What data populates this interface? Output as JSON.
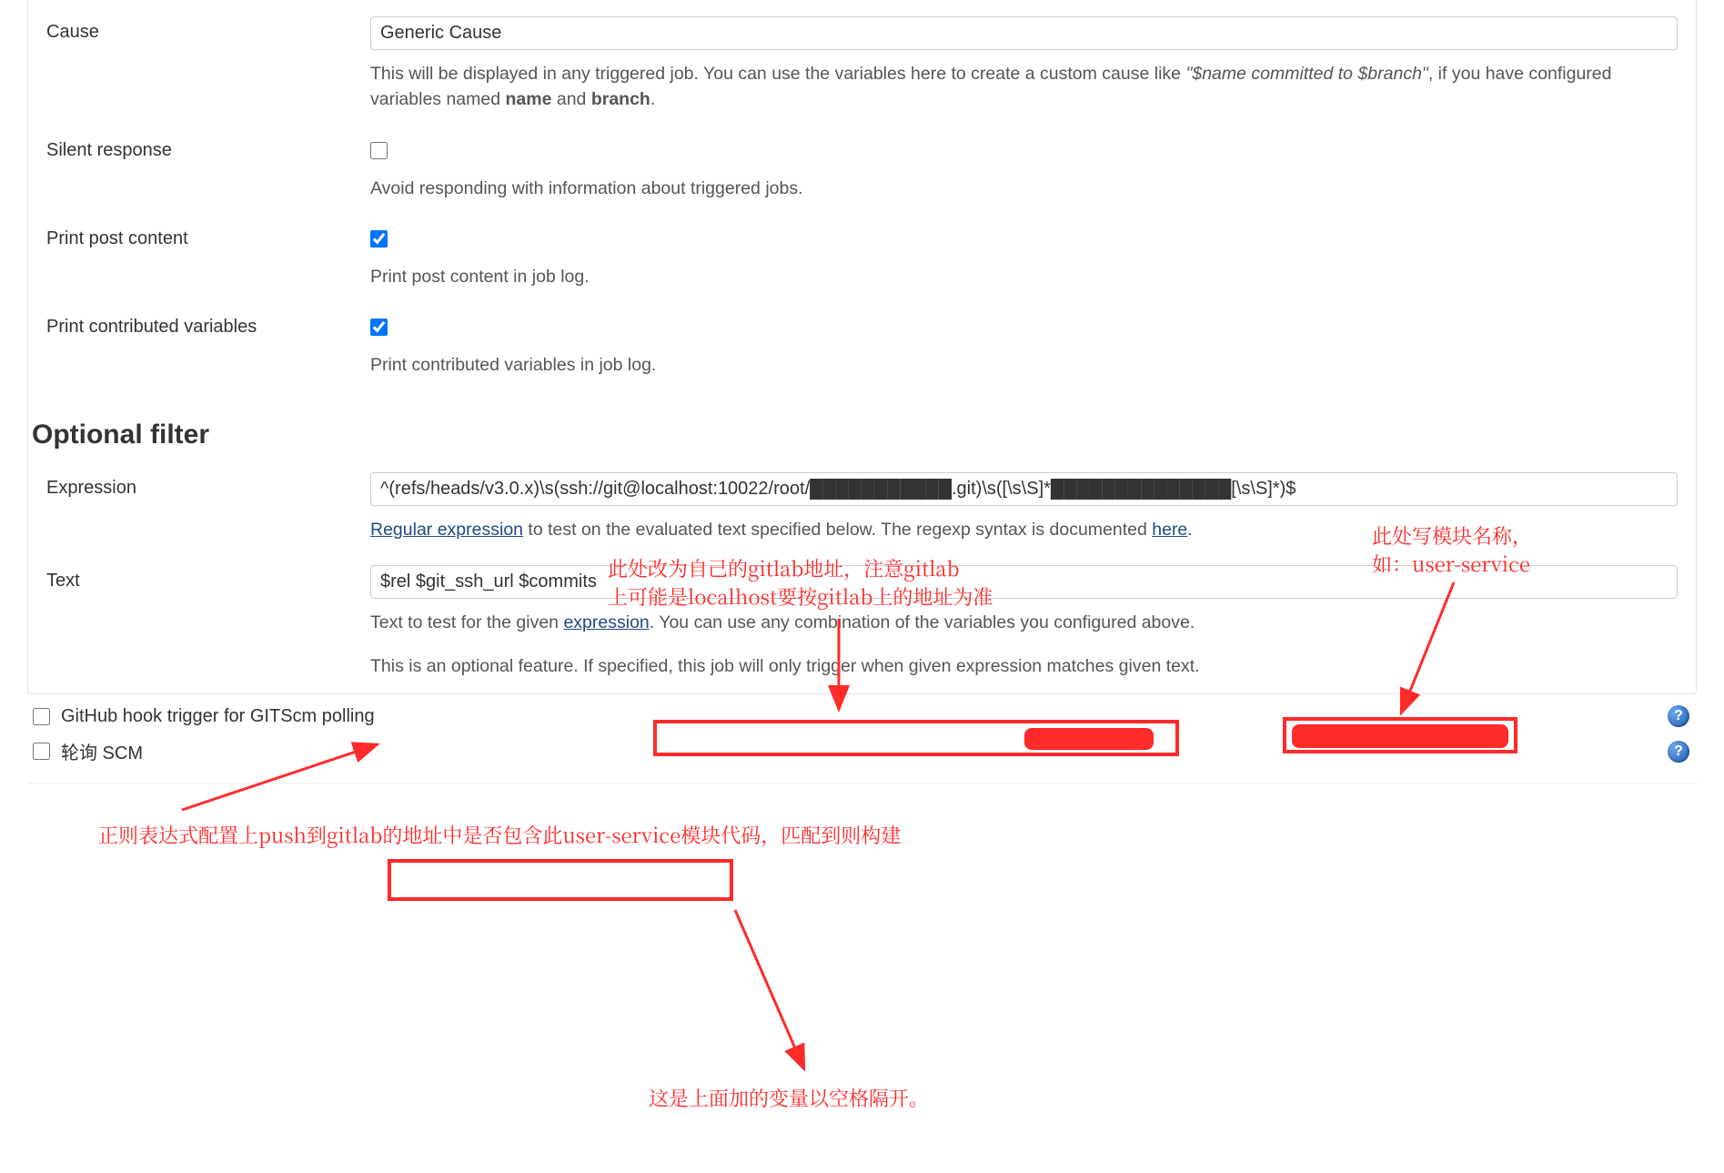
{
  "cause": {
    "label": "Cause",
    "value": "Generic Cause",
    "help_prefix": "This will be displayed in any triggered job. You can use the variables here to create a custom cause like ",
    "help_italic": "\"$name committed to $branch\"",
    "help_mid": ", if you have configured variables named ",
    "help_b1": "name",
    "help_and": " and ",
    "help_b2": "branch",
    "help_end": "."
  },
  "silent": {
    "label": "Silent response",
    "help": "Avoid responding with information about triggered jobs."
  },
  "print_post": {
    "label": "Print post content",
    "help": "Print post content in job log."
  },
  "print_vars": {
    "label": "Print contributed variables",
    "help": "Print contributed variables in job log."
  },
  "optional_filter": {
    "heading": "Optional filter",
    "expression_label": "Expression",
    "expression_value": "^(refs/heads/v3.0.x)\\s(ssh://git@localhost:10022/root/███████████.git)\\s([\\s\\S]*██████████████[\\s\\S]*)$",
    "expression_help_link1": "Regular expression",
    "expression_help_mid": " to test on the evaluated text specified below. The regexp syntax is documented ",
    "expression_help_link2": "here",
    "expression_help_end": ".",
    "text_label": "Text",
    "text_value": "$rel $git_ssh_url $commits",
    "text_help_pre": "Text to test for the given ",
    "text_help_link": "expression",
    "text_help_post": ". You can use any combination of the variables you configured above.",
    "note": "This is an optional feature. If specified, this job will only trigger when given expression matches given text."
  },
  "github_hook": {
    "label": "GitHub hook trigger for GITScm polling"
  },
  "poll_scm": {
    "label": "轮询 SCM"
  },
  "annotations": {
    "gitlab_addr_l1": "此处改为自己的gitlab地址，注意gitlab",
    "gitlab_addr_l2": "上可能是localhost要按gitlab上的地址为准",
    "module_name_l1": "此处写模块名称，",
    "module_name_l2": "如：user-service",
    "regex_note": "正则表达式配置上push到gitlab的地址中是否包含此user-service模块代码，匹配到则构建",
    "vars_note": "这是上面加的变量以空格隔开。"
  }
}
